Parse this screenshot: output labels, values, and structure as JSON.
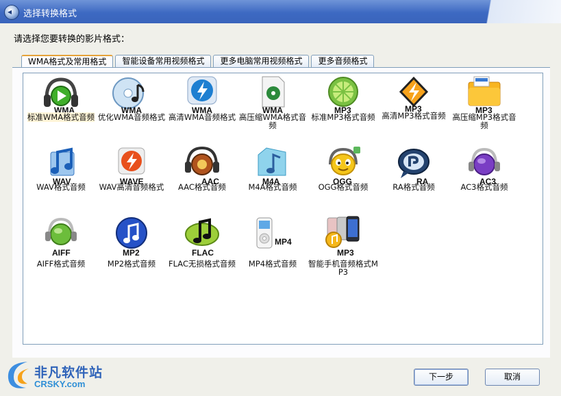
{
  "window": {
    "title": "选择转换格式"
  },
  "instruction": "请选择您要转换的影片格式：",
  "tabs": [
    {
      "label": "WMA格式及常用格式",
      "active": true
    },
    {
      "label": "智能设备常用视频格式",
      "active": false
    },
    {
      "label": "更多电脑常用视频格式",
      "active": false
    },
    {
      "label": "更多音频格式",
      "active": false
    }
  ],
  "formats": [
    {
      "badge": "WMA",
      "label": "标准WMA格式音频",
      "icon": "headphones-play-icon",
      "selected": true
    },
    {
      "badge": "WMA",
      "label": "优化WMA音频格式",
      "icon": "cd-music-icon",
      "selected": false
    },
    {
      "badge": "WMA",
      "label": "高清WMA音频格式",
      "icon": "lightning-icon",
      "selected": false
    },
    {
      "badge": "WMA",
      "label": "高压缩WMA格式音频",
      "icon": "document-disc-icon",
      "selected": false
    },
    {
      "badge": "MP3",
      "label": "标准MP3格式音频",
      "icon": "lime-icon",
      "selected": false
    },
    {
      "badge": "MP3",
      "label": "高清MP3格式音频",
      "icon": "winamp-bolt-icon",
      "selected": false
    },
    {
      "badge": "MP3",
      "label": "高压缩MP3格式音频",
      "icon": "mp3-folder-icon",
      "selected": false
    },
    {
      "badge": "WAV",
      "label": "WAV格式音频",
      "icon": "music-note-blue-icon",
      "selected": false
    },
    {
      "badge": "WAVE",
      "label": "WAV高清音频格式",
      "icon": "orange-bolt-icon",
      "selected": false
    },
    {
      "badge": "AAC",
      "label": "AAC格式音频",
      "icon": "disco-headphones-icon",
      "selected": false
    },
    {
      "badge": "M4A",
      "label": "M4A格式音频",
      "icon": "music-folder-icon",
      "selected": false
    },
    {
      "badge": "OGG",
      "label": "OGG格式音频",
      "icon": "smiley-headphones-icon",
      "selected": false
    },
    {
      "badge": "RA",
      "label": "RA格式音频",
      "icon": "real-audio-icon",
      "selected": false
    },
    {
      "badge": "AC3",
      "label": "AC3格式音频",
      "icon": "purple-headphones-icon",
      "selected": false
    },
    {
      "badge": "AIFF",
      "label": "AIFF格式音频",
      "icon": "green-headphones-icon",
      "selected": false
    },
    {
      "badge": "MP2",
      "label": "MP2格式音频",
      "icon": "blue-note-circle-icon",
      "selected": false
    },
    {
      "badge": "FLAC",
      "label": "FLAC无损格式音频",
      "icon": "flac-note-icon",
      "selected": false
    },
    {
      "badge": "MP4",
      "label": "MP4格式音频",
      "icon": "ipod-icon",
      "selected": false
    },
    {
      "badge": "MP3",
      "label": "智能手机音频格式MP3",
      "icon": "smartphones-icon",
      "selected": false
    }
  ],
  "buttons": {
    "next": "下一步",
    "cancel": "取消"
  },
  "watermark": {
    "cn": "非凡软件站",
    "en": "CRSKY.com"
  },
  "colors": {
    "titlebar": "#3d69c2",
    "panel_border": "#7f9db9",
    "active_tab_accent": "#e6a238",
    "background": "#f0f0ea"
  }
}
